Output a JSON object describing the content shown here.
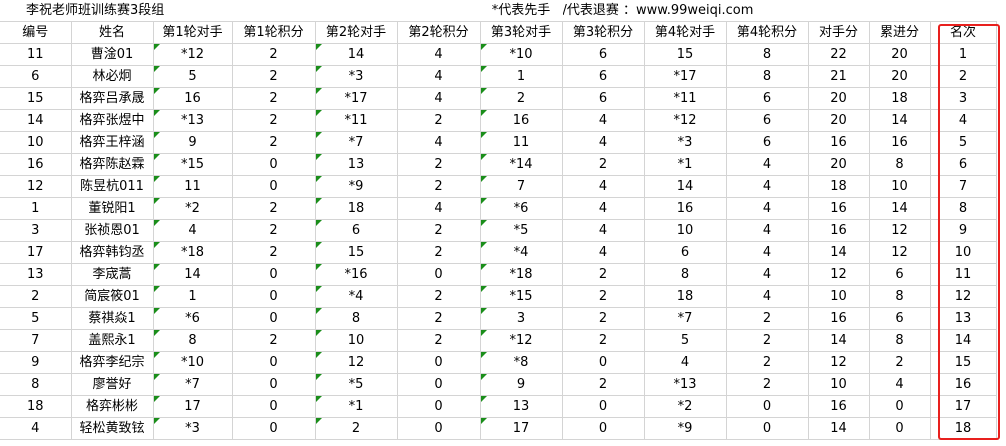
{
  "title": "李祝老师班训练赛3段组",
  "note_first": "*代表先手",
  "note_quit": "/代表退赛 ：www.99weiqi.com",
  "headers": [
    "编号",
    "姓名",
    "第1轮对手",
    "第1轮积分",
    "第2轮对手",
    "第2轮积分",
    "第3轮对手",
    "第3轮积分",
    "第4轮对手",
    "第4轮积分",
    "对手分",
    "累进分",
    "名次"
  ],
  "rows": [
    [
      "11",
      "曹淦01",
      "*12",
      "2",
      "14",
      "4",
      "*10",
      "6",
      "15",
      "8",
      "22",
      "20",
      "1"
    ],
    [
      "6",
      "林必炯",
      "5",
      "2",
      "*3",
      "4",
      "1",
      "6",
      "*17",
      "8",
      "21",
      "20",
      "2"
    ],
    [
      "15",
      "格弈吕承晟",
      "16",
      "2",
      "*17",
      "4",
      "2",
      "6",
      "*11",
      "6",
      "20",
      "18",
      "3"
    ],
    [
      "14",
      "格弈张煜中",
      "*13",
      "2",
      "*11",
      "2",
      "16",
      "4",
      "*12",
      "6",
      "20",
      "14",
      "4"
    ],
    [
      "10",
      "格弈王梓涵",
      "9",
      "2",
      "*7",
      "4",
      "11",
      "4",
      "*3",
      "6",
      "16",
      "16",
      "5"
    ],
    [
      "16",
      "格弈陈赵霖",
      "*15",
      "0",
      "13",
      "2",
      "*14",
      "2",
      "*1",
      "4",
      "20",
      "8",
      "6"
    ],
    [
      "12",
      "陈昱杭011",
      "11",
      "0",
      "*9",
      "2",
      "7",
      "4",
      "14",
      "4",
      "18",
      "10",
      "7"
    ],
    [
      "1",
      "董锐阳1",
      "*2",
      "2",
      "18",
      "4",
      "*6",
      "4",
      "16",
      "4",
      "16",
      "14",
      "8"
    ],
    [
      "3",
      "张祯恩01",
      "4",
      "2",
      "6",
      "2",
      "*5",
      "4",
      "10",
      "4",
      "16",
      "12",
      "9"
    ],
    [
      "17",
      "格弈韩钧丞",
      "*18",
      "2",
      "15",
      "2",
      "*4",
      "4",
      "6",
      "4",
      "14",
      "12",
      "10"
    ],
    [
      "13",
      "李宬蒿",
      "14",
      "0",
      "*16",
      "0",
      "*18",
      "2",
      "8",
      "4",
      "12",
      "6",
      "11"
    ],
    [
      "2",
      "简宸筱01",
      "1",
      "0",
      "*4",
      "2",
      "*15",
      "2",
      "18",
      "4",
      "10",
      "8",
      "12"
    ],
    [
      "5",
      "蔡祺焱1",
      "*6",
      "0",
      "8",
      "2",
      "3",
      "2",
      "*7",
      "2",
      "16",
      "6",
      "13"
    ],
    [
      "7",
      "盖熙永1",
      "8",
      "2",
      "10",
      "2",
      "*12",
      "2",
      "5",
      "2",
      "14",
      "8",
      "14"
    ],
    [
      "9",
      "格弈李纪宗",
      "*10",
      "0",
      "12",
      "0",
      "*8",
      "0",
      "4",
      "2",
      "12",
      "2",
      "15"
    ],
    [
      "8",
      "廖誉好",
      "*7",
      "0",
      "*5",
      "0",
      "9",
      "2",
      "*13",
      "2",
      "10",
      "4",
      "16"
    ],
    [
      "18",
      "格弈彬彬",
      "17",
      "0",
      "*1",
      "0",
      "13",
      "0",
      "*2",
      "0",
      "16",
      "0",
      "17"
    ],
    [
      "4",
      "轻松黄致铉",
      "*3",
      "0",
      "2",
      "0",
      "17",
      "0",
      "*9",
      "0",
      "14",
      "0",
      "18"
    ]
  ],
  "marker_color": "#1a8e1a",
  "highlight_color": "#e8201e"
}
